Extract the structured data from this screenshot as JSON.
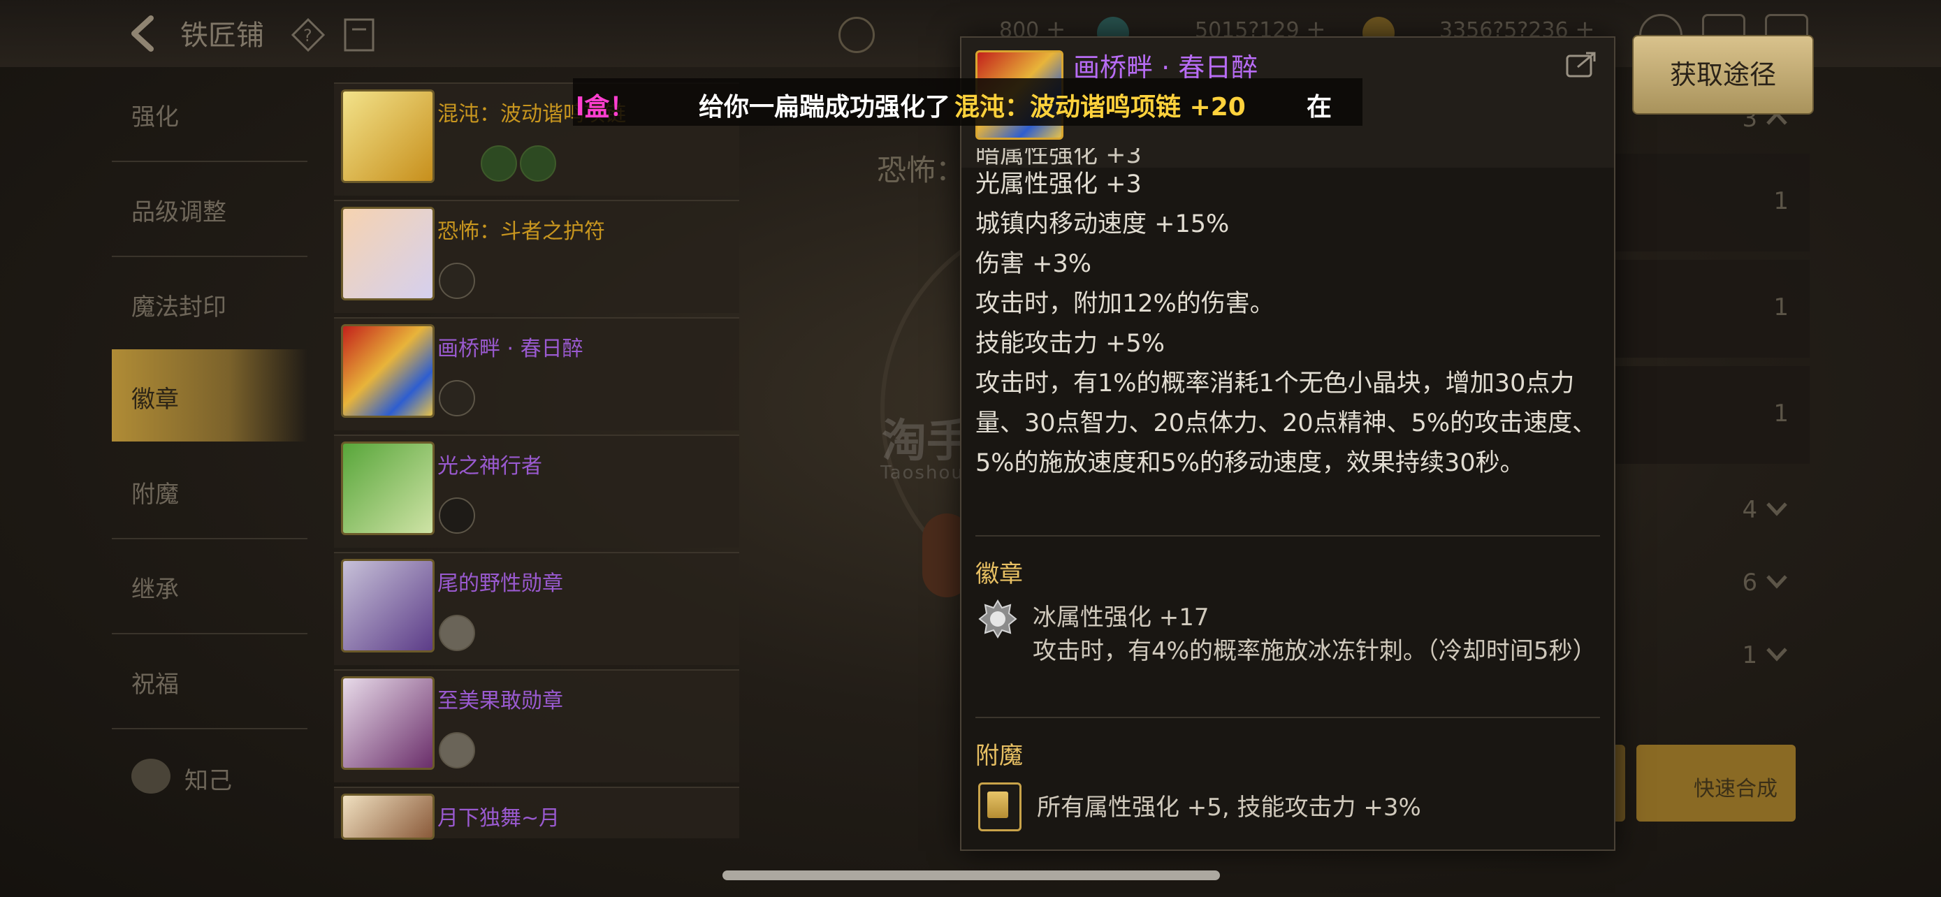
{
  "topbar": {
    "title": "铁匠铺",
    "currencies": [
      "800",
      "5015?129",
      "3356?5?236"
    ]
  },
  "menu": {
    "items": [
      "强化",
      "品级调整",
      "魔法封印",
      "徽章",
      "附魔",
      "继承",
      "祝福"
    ],
    "bottom_label": "知己",
    "active_index": 3
  },
  "list": {
    "items": [
      {
        "name": "混沌：波动谐鸣项链",
        "color": "#d6a52a"
      },
      {
        "name": "恐怖：斗者之护符",
        "color": "#d6a52a"
      },
      {
        "name": "画桥畔 · 春日醉",
        "color": "#b86cf5"
      },
      {
        "name": "光之神行者",
        "color": "#b86cf5"
      },
      {
        "name": "尾的野性勋章",
        "color": "#b86cf5"
      },
      {
        "name": "至美果敢勋章",
        "color": "#b86cf5"
      },
      {
        "name": "月下独舞~月",
        "color": "#b86cf5"
      }
    ]
  },
  "middle": {
    "title": "恐怖："
  },
  "right_panel": {
    "numbers": [
      "3",
      "1",
      "1",
      "1",
      "4",
      "6",
      "1"
    ],
    "quick_synth_label": "快速合成"
  },
  "marquee": {
    "part1": "l盒！",
    "part2": "给你一扁踹成功强化了",
    "part3": "混沌：波动谐鸣项链 +20",
    "part4": "在下/"
  },
  "tooltip": {
    "title": "画桥畔 · 春日醉",
    "lines": [
      "暗属性强化 +3",
      "光属性强化 +3",
      "城镇内移动速度 +15%",
      "伤害 +3%",
      "攻击时，附加12%的伤害。",
      "技能攻击力 +5%"
    ],
    "paragraph": "攻击时，有1%的概率消耗1个无色小晶块，增加30点力量、30点智力、20点体力、20点精神、5%的攻击速度、5%的施放速度和5%的移动速度，效果持续30秒。",
    "emblem_section": "徽章",
    "emblem_line1": "冰属性强化 +17",
    "emblem_line2": "攻击时，有4%的概率施放冰冻针刺。（冷却时间5秒）",
    "enchant_section": "附魔",
    "enchant_text": "所有属性强化 +5, 技能攻击力 +3%"
  },
  "acquire_button": "获取途径",
  "watermark": {
    "main": "淘手游",
    "sub": "Taoshouyou"
  },
  "icons": [
    "back-icon",
    "help-icon",
    "book-icon",
    "coin-icon",
    "share-icon",
    "emblem-icon",
    "enchant-card-icon",
    "chevron-up-icon",
    "chevron-down-icon"
  ]
}
